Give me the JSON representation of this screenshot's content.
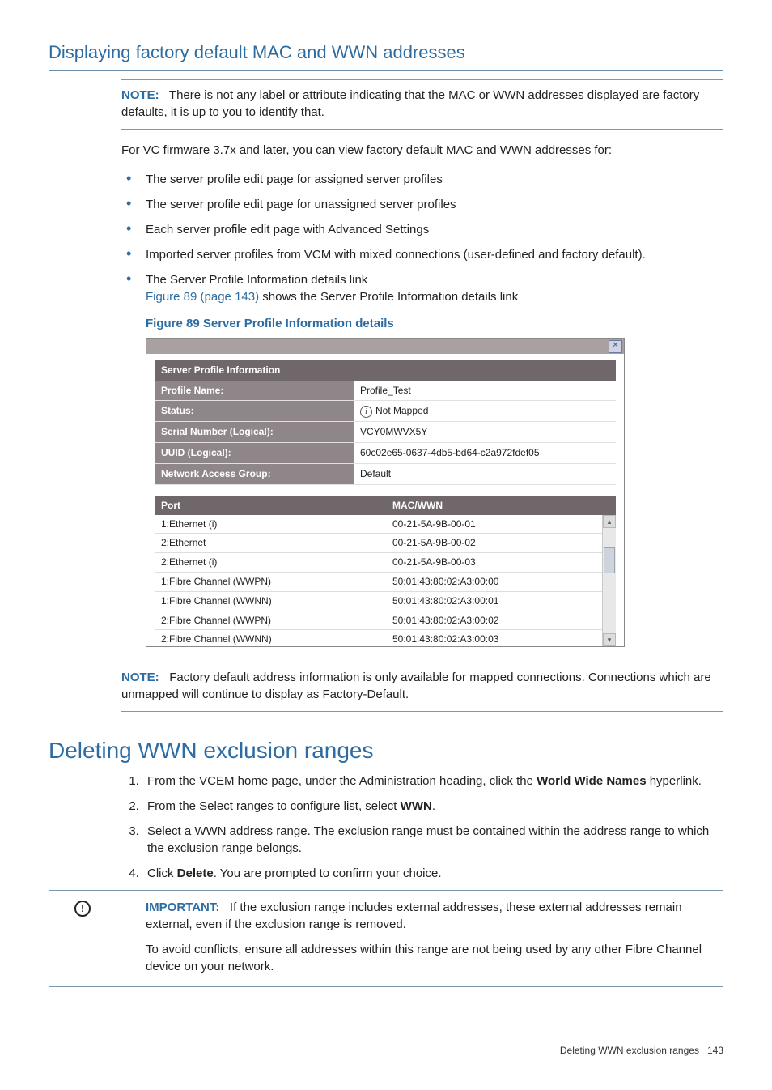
{
  "section1": {
    "title": "Displaying factory default MAC and WWN addresses",
    "note": {
      "label": "NOTE:",
      "text": "There is not any label or attribute indicating that the MAC or WWN addresses displayed are factory defaults, it is up to you to identify that."
    },
    "intro": "For VC firmware 3.7x and later, you can view factory default MAC and WWN addresses for:",
    "bullets": [
      "The server profile edit page for assigned server profiles",
      "The server profile edit page for unassigned server profiles",
      "Each server profile edit page with Advanced Settings",
      "Imported server profiles from VCM with mixed connections (user-defined and factory default).",
      "The Server Profile Information details link"
    ],
    "figref_link": "Figure 89 (page 143)",
    "figref_rest": " shows the Server Profile Information details link",
    "fig_caption": "Figure 89 Server Profile Information details"
  },
  "screenshot": {
    "panel_title": "Server Profile Information",
    "rows": [
      {
        "k": "Profile Name:",
        "v": "Profile_Test"
      },
      {
        "k": "Status:",
        "v": "Not Mapped",
        "icon": true
      },
      {
        "k": "Serial Number (Logical):",
        "v": "VCY0MWVX5Y"
      },
      {
        "k": "UUID (Logical):",
        "v": "60c02e65-0637-4db5-bd64-c2a972fdef05"
      },
      {
        "k": "Network Access Group:",
        "v": "Default"
      }
    ],
    "port_headers": {
      "c1": "Port",
      "c2": "MAC/WWN"
    },
    "ports": [
      {
        "p": "1:Ethernet (i)",
        "m": "00-21-5A-9B-00-01"
      },
      {
        "p": "2:Ethernet",
        "m": "00-21-5A-9B-00-02"
      },
      {
        "p": "2:Ethernet (i)",
        "m": "00-21-5A-9B-00-03"
      },
      {
        "p": "1:Fibre Channel (WWPN)",
        "m": "50:01:43:80:02:A3:00:00"
      },
      {
        "p": "1:Fibre Channel (WWNN)",
        "m": "50:01:43:80:02:A3:00:01"
      },
      {
        "p": "2:Fibre Channel (WWPN)",
        "m": "50:01:43:80:02:A3:00:02"
      },
      {
        "p": "2:Fibre Channel (WWNN)",
        "m": "50:01:43:80:02:A3:00:03"
      }
    ]
  },
  "note2": {
    "label": "NOTE:",
    "text": "Factory default address information is only available for mapped connections. Connections which are unmapped will continue to display as Factory-Default."
  },
  "section2": {
    "title": "Deleting WWN exclusion ranges",
    "steps_pre": [
      "From the VCEM home page, under the Administration heading, click the ",
      " hyperlink."
    ],
    "steps_bold1": "World Wide Names",
    "step2_pre": "From the Select ranges to configure list, select ",
    "step2_bold": "WWN",
    "step2_post": ".",
    "step3": "Select a WWN address range. The exclusion range must be contained within the address range to which the exclusion range belongs.",
    "step4_pre": "Click ",
    "step4_bold": "Delete",
    "step4_post": ". You are prompted to confirm your choice.",
    "important": {
      "label": "IMPORTANT:",
      "p1": "If the exclusion range includes external addresses, these external addresses remain external, even if the exclusion range is removed.",
      "p2": "To avoid conflicts, ensure all addresses within this range are not being used by any other Fibre Channel device on your network."
    }
  },
  "footer": {
    "text": "Deleting WWN exclusion ranges",
    "page": "143"
  }
}
